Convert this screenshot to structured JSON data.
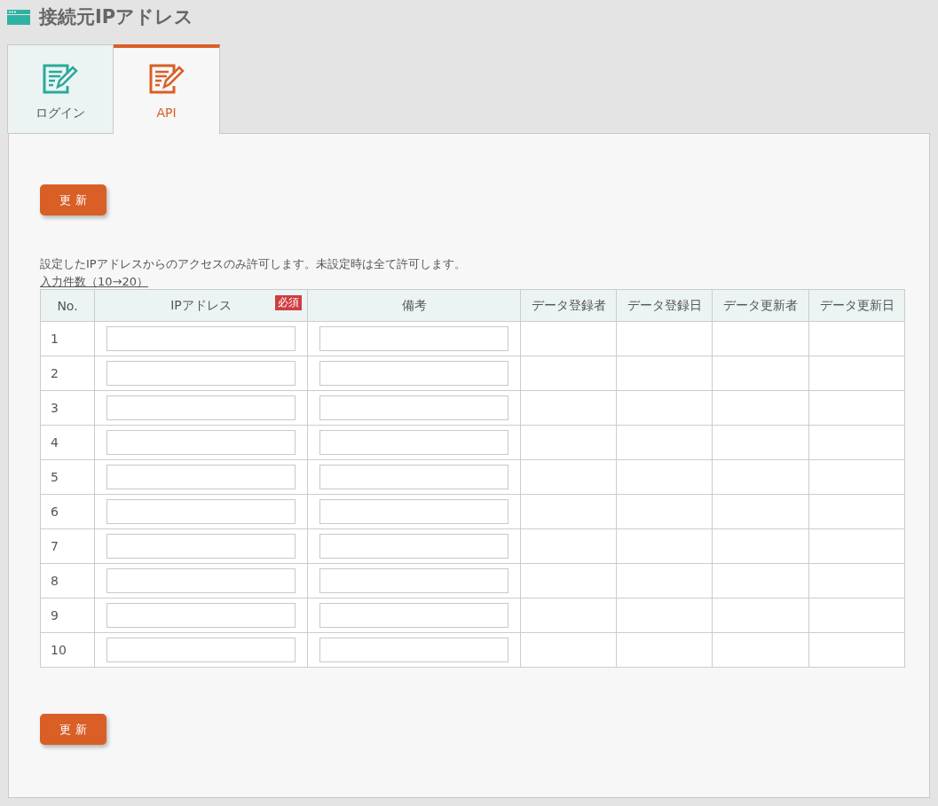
{
  "page_title": "接続元IPアドレス",
  "tabs": [
    {
      "label": "ログイン",
      "selected": false
    },
    {
      "label": "API",
      "selected": true
    }
  ],
  "update_button_top": "更 新",
  "description": "設定したIPアドレスからのアクセスのみ許可します。未設定時は全て許可します。",
  "count_link": "入力件数（10→20）",
  "table": {
    "columns": [
      {
        "label": "No.",
        "kind": "number"
      },
      {
        "label": "IPアドレス",
        "kind": "input",
        "badge": "必須"
      },
      {
        "label": "備考",
        "kind": "input"
      },
      {
        "label": "データ登録者",
        "kind": "text"
      },
      {
        "label": "データ登録日",
        "kind": "text"
      },
      {
        "label": "データ更新者",
        "kind": "text"
      },
      {
        "label": "データ更新日",
        "kind": "text"
      }
    ],
    "rows": [
      {
        "no": "1"
      },
      {
        "no": "2"
      },
      {
        "no": "3"
      },
      {
        "no": "4"
      },
      {
        "no": "5"
      },
      {
        "no": "6"
      },
      {
        "no": "7"
      },
      {
        "no": "8"
      },
      {
        "no": "9"
      },
      {
        "no": "10"
      }
    ]
  },
  "update_button_bottom": "更 新"
}
